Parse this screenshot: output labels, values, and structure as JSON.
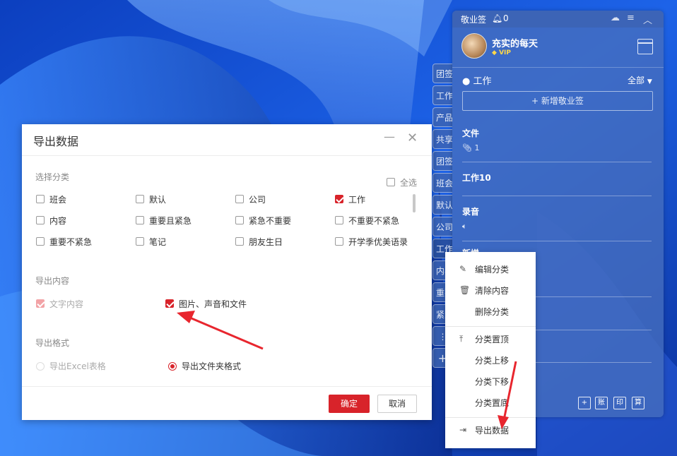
{
  "app": {
    "name": "敬业签",
    "notify_count": "0",
    "user_name": "充实的每天",
    "vip": "VIP",
    "category_title": "工作",
    "filter": "全部",
    "add_note": "新增敬业签",
    "notes": [
      {
        "title": "文件",
        "sub": "1"
      },
      {
        "title": "工作10",
        "sub": ""
      },
      {
        "title": "录音",
        "sub": ""
      },
      {
        "title": "新增",
        "sub": ""
      }
    ],
    "footer": {
      "plus": "+",
      "account": "账",
      "print": "印",
      "calc": "算"
    }
  },
  "side_tabs": [
    "团签",
    "工作",
    "产品",
    "共享",
    "团签",
    "班会",
    "默认",
    "公司",
    "工作",
    "内容",
    "重要",
    "紧急",
    "⋮",
    "+"
  ],
  "context_menu": {
    "items": [
      {
        "label": "编辑分类",
        "icon": "✎"
      },
      {
        "label": "清除内容",
        "icon": "🗑"
      },
      {
        "label": "删除分类",
        "icon": ""
      },
      {
        "label": "分类置顶",
        "icon": "⤒"
      },
      {
        "label": "分类上移",
        "icon": ""
      },
      {
        "label": "分类下移",
        "icon": ""
      },
      {
        "label": "分类置底",
        "icon": ""
      },
      {
        "label": "导出数据",
        "icon": "⇥"
      }
    ]
  },
  "dialog": {
    "title": "导出数据",
    "select_category_label": "选择分类",
    "select_all": "全选",
    "categories": [
      {
        "label": "班会",
        "checked": false
      },
      {
        "label": "默认",
        "checked": false
      },
      {
        "label": "公司",
        "checked": false
      },
      {
        "label": "工作",
        "checked": true
      },
      {
        "label": "内容",
        "checked": false
      },
      {
        "label": "重要且紧急",
        "checked": false
      },
      {
        "label": "紧急不重要",
        "checked": false
      },
      {
        "label": "不重要不紧急",
        "checked": false
      },
      {
        "label": "重要不紧急",
        "checked": false
      },
      {
        "label": "笔记",
        "checked": false
      },
      {
        "label": "朋友生日",
        "checked": false
      },
      {
        "label": "开学季优美语录",
        "checked": false
      }
    ],
    "export_content_label": "导出内容",
    "content_text": "文字内容",
    "content_media": "图片、声音和文件",
    "export_format_label": "导出格式",
    "format_excel": "导出Excel表格",
    "format_folder": "导出文件夹格式",
    "ok": "确定",
    "cancel": "取消"
  },
  "colors": {
    "accent": "#d8232a",
    "wallpaper": "#1f56d6",
    "panel": "#466ebe"
  }
}
